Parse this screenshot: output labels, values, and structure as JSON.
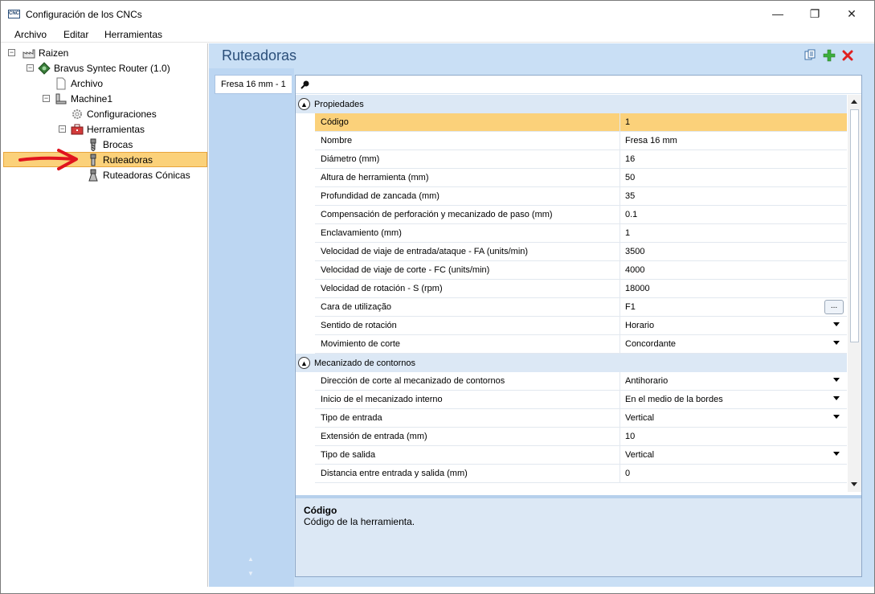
{
  "window": {
    "app_icon_text": "CNC",
    "title": "Configuración de los CNCs",
    "minimize_glyph": "—",
    "maximize_glyph": "❐",
    "close_glyph": "✕"
  },
  "menu": [
    "Archivo",
    "Editar",
    "Herramientas"
  ],
  "tree": {
    "items": [
      {
        "label": "Raizen",
        "icon": "factory-icon"
      },
      {
        "label": "Bravus Syntec Router (1.0)",
        "icon": "machine-diamond-icon"
      },
      {
        "label": "Archivo",
        "icon": "file-icon"
      },
      {
        "label": "Machine1",
        "icon": "machine-icon"
      },
      {
        "label": "Configuraciones",
        "icon": "gear-icon"
      },
      {
        "label": "Herramientas",
        "icon": "toolbox-icon"
      },
      {
        "label": "Brocas",
        "icon": "drill-bit-icon"
      },
      {
        "label": "Ruteadoras",
        "icon": "router-bit-icon",
        "selected": true
      },
      {
        "label": "Ruteadoras Cónicas",
        "icon": "conical-bit-icon"
      }
    ]
  },
  "panel": {
    "title": "Ruteadoras",
    "actions": [
      "copy-icon",
      "add-icon",
      "delete-icon"
    ],
    "accent_color": "#2b4f7a",
    "add_color": "#3cae3c",
    "delete_color": "#e02020"
  },
  "tabs": [
    {
      "label": "Fresa 16 mm - 1"
    }
  ],
  "property_grid": {
    "categories": [
      {
        "name": "Propiedades",
        "rows": [
          {
            "name": "Código",
            "value": "1",
            "selected": true
          },
          {
            "name": "Nombre",
            "value": "Fresa 16 mm"
          },
          {
            "name": "Diámetro (mm)",
            "value": "16"
          },
          {
            "name": "Altura de herramienta (mm)",
            "value": "50"
          },
          {
            "name": "Profundidad de zancada (mm)",
            "value": "35"
          },
          {
            "name": "Compensación de perforación y mecanizado de paso (mm)",
            "value": "0.1"
          },
          {
            "name": "Enclavamiento (mm)",
            "value": "1"
          },
          {
            "name": "Velocidad de viaje de entrada/ataque - FA (units/min)",
            "value": "3500"
          },
          {
            "name": "Velocidad de viaje de corte - FC (units/min)",
            "value": "4000"
          },
          {
            "name": "Velocidad de rotación - S (rpm)",
            "value": "18000"
          },
          {
            "name": "Cara de utilização",
            "value": "F1",
            "editor": "ellipsis",
            "editor_label": "..."
          },
          {
            "name": "Sentido de rotación",
            "value": "Horario",
            "editor": "dropdown"
          },
          {
            "name": "Movimiento de corte",
            "value": "Concordante",
            "editor": "dropdown"
          }
        ]
      },
      {
        "name": "Mecanizado de contornos",
        "rows": [
          {
            "name": "Dirección de corte al mecanizado de contornos",
            "value": "Antihorario",
            "editor": "dropdown"
          },
          {
            "name": "Inicio de el mecanizado interno",
            "value": "En el medio de la bordes",
            "editor": "dropdown"
          },
          {
            "name": "Tipo de entrada",
            "value": "Vertical",
            "editor": "dropdown"
          },
          {
            "name": "Extensión de entrada (mm)",
            "value": "10"
          },
          {
            "name": "Tipo de salida",
            "value": "Vertical",
            "editor": "dropdown"
          },
          {
            "name": "Distancia entre entrada y salida (mm)",
            "value": "0"
          }
        ]
      }
    ],
    "selection_color": "#fbd17a",
    "category_color": "#dce8f5"
  },
  "description": {
    "title": "Código",
    "text": "Código de la herramienta."
  }
}
